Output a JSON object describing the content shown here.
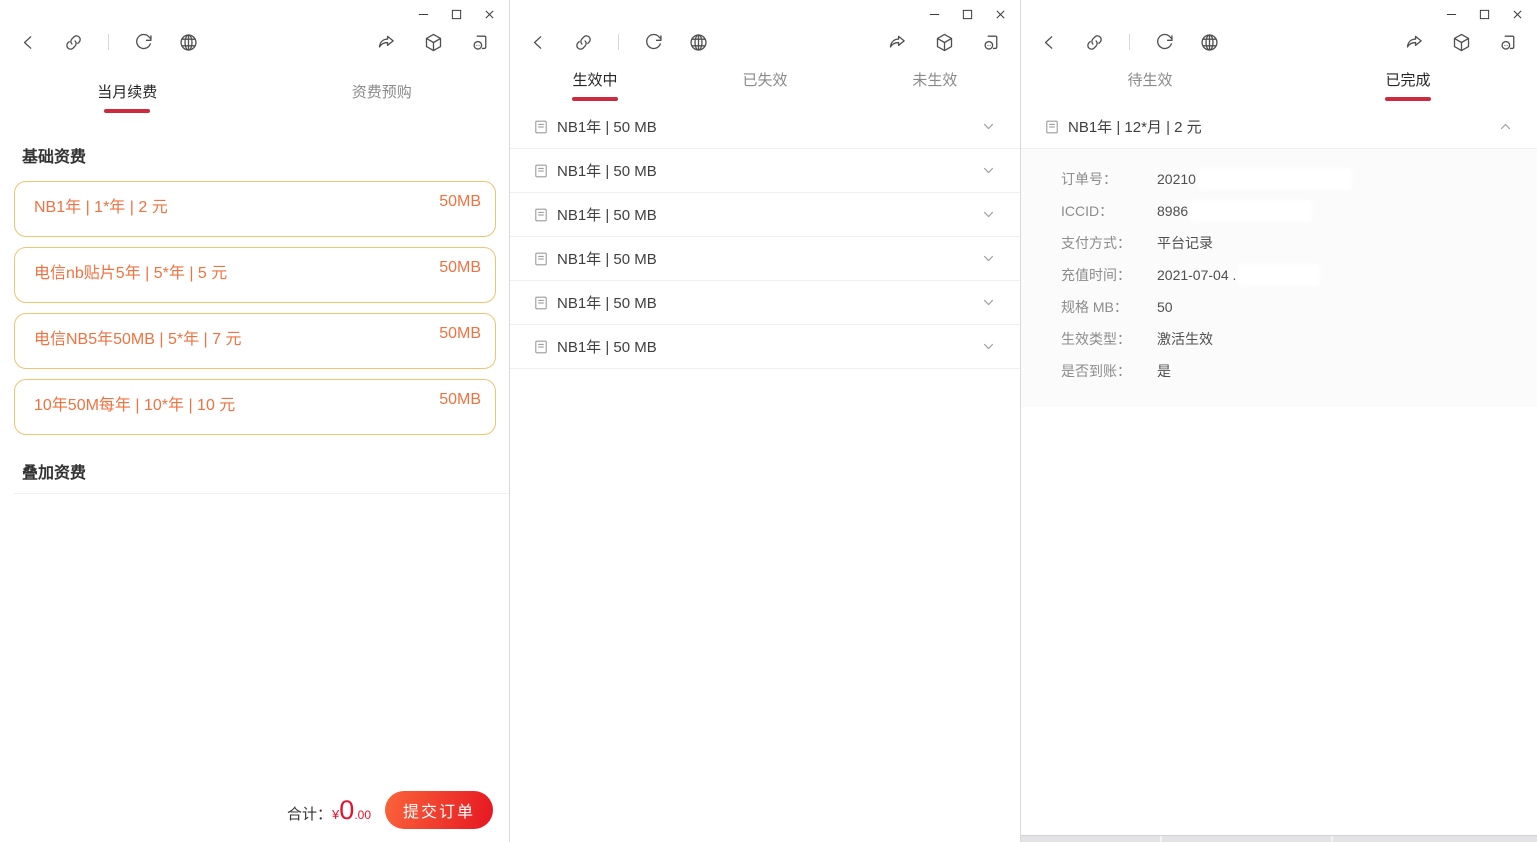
{
  "colors": {
    "accent_red": "#ce2a3d",
    "amount_red": "#e8112d",
    "card_border": "#eac572",
    "card_text": "#ef7240",
    "button_gradient_start": "#f9603a",
    "button_gradient_end": "#e71a22",
    "toolbar_icon": "#4f4f4f"
  },
  "w1": {
    "tabs": [
      {
        "label": "当月续费"
      },
      {
        "label": "资费预购"
      }
    ],
    "section_basic": "基础资费",
    "section_addon": "叠加资费",
    "cards": [
      {
        "title": "NB1年 | 1*年 | 2 元",
        "quota": "50MB"
      },
      {
        "title": "电信nb贴片5年 | 5*年 | 5 元",
        "quota": "50MB"
      },
      {
        "title": "电信NB5年50MB | 5*年 | 7 元",
        "quota": "50MB"
      },
      {
        "title": "10年50M每年 | 10*年 | 10 元",
        "quota": "50MB"
      }
    ],
    "footer": {
      "total_label": "合计：",
      "currency": "¥",
      "amount_int": "0",
      "amount_dec": ".00",
      "submit": "提交订单"
    }
  },
  "w2": {
    "tabs": [
      {
        "label": "生效中"
      },
      {
        "label": "已失效"
      },
      {
        "label": "未生效"
      }
    ],
    "items": [
      {
        "title": "NB1年 | 50 MB"
      },
      {
        "title": "NB1年 | 50 MB"
      },
      {
        "title": "NB1年 | 50 MB"
      },
      {
        "title": "NB1年 | 50 MB"
      },
      {
        "title": "NB1年 | 50 MB"
      },
      {
        "title": "NB1年 | 50 MB"
      }
    ]
  },
  "w3": {
    "tabs": [
      {
        "label": "待生效"
      },
      {
        "label": "已完成"
      }
    ],
    "item": {
      "title": "NB1年 | 12*月 | 2 元"
    },
    "details": [
      {
        "label": "订单号：",
        "value": "20210"
      },
      {
        "label": "ICCID：",
        "value": "8986"
      },
      {
        "label": "支付方式：",
        "value": "平台记录"
      },
      {
        "label": "充值时间：",
        "value": "2021-07-04 ."
      },
      {
        "label": "规格 MB：",
        "value": "50"
      },
      {
        "label": "生效类型：",
        "value": "激活生效"
      },
      {
        "label": "是否到账：",
        "value": "是"
      }
    ]
  }
}
